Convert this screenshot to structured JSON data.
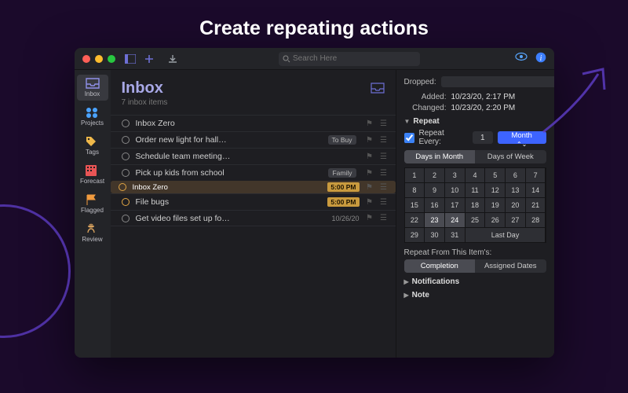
{
  "page_title": "Create repeating actions",
  "search_placeholder": "Search Here",
  "sidebar": [
    {
      "id": "inbox",
      "label": "Inbox",
      "active": true
    },
    {
      "id": "projects",
      "label": "Projects"
    },
    {
      "id": "tags",
      "label": "Tags"
    },
    {
      "id": "forecast",
      "label": "Forecast"
    },
    {
      "id": "flagged",
      "label": "Flagged"
    },
    {
      "id": "review",
      "label": "Review"
    }
  ],
  "list": {
    "title": "Inbox",
    "subtitle": "7 inbox items",
    "items": [
      {
        "title": "Inbox Zero",
        "tag": "",
        "right": "",
        "selected": false,
        "warm": false
      },
      {
        "title": "Order new light for hall…",
        "tag": "To Buy",
        "right": "",
        "selected": false,
        "warm": false
      },
      {
        "title": "Schedule team meeting…",
        "tag": "",
        "right": "",
        "selected": false,
        "warm": false
      },
      {
        "title": "Pick up kids from school",
        "tag": "Family",
        "right": "",
        "selected": false,
        "warm": false
      },
      {
        "title": "Inbox Zero",
        "tag": "",
        "right": "5:00 PM",
        "right_kind": "due",
        "selected": true,
        "warm": true
      },
      {
        "title": "File bugs",
        "tag": "",
        "right": "5:00 PM",
        "right_kind": "due",
        "selected": false,
        "warm": true
      },
      {
        "title": "Get video files set up fo…",
        "tag": "",
        "right": "10/26/20",
        "right_kind": "date",
        "selected": false,
        "warm": false
      }
    ]
  },
  "inspector": {
    "dropped_label": "Dropped:",
    "added_label": "Added:",
    "added_value": "10/23/20, 2:17 PM",
    "changed_label": "Changed:",
    "changed_value": "10/23/20, 2:20 PM",
    "repeat_section": "Repeat",
    "repeat_every_label": "Repeat Every:",
    "repeat_every_checked": true,
    "repeat_value": "1",
    "repeat_unit": "Month",
    "seg_days_month": "Days in Month",
    "seg_days_week": "Days of Week",
    "calendar_days": [
      "1",
      "2",
      "3",
      "4",
      "5",
      "6",
      "7",
      "8",
      "9",
      "10",
      "11",
      "12",
      "13",
      "14",
      "15",
      "16",
      "17",
      "18",
      "19",
      "20",
      "21",
      "22",
      "23",
      "24",
      "25",
      "26",
      "27",
      "28",
      "29",
      "30",
      "31"
    ],
    "calendar_selected": [
      23,
      24
    ],
    "last_day_label": "Last Day",
    "repeat_from_label": "Repeat From This Item's:",
    "seg_completion": "Completion",
    "seg_assigned": "Assigned Dates",
    "notifications_section": "Notifications",
    "note_section": "Note"
  }
}
